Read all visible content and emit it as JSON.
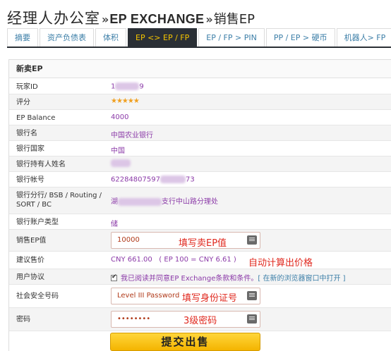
{
  "header": {
    "main": "经理人办公室",
    "sep1": "»",
    "section": "EP EXCHANGE",
    "sep2": "»",
    "sub": "销售EP"
  },
  "tabs": [
    {
      "label": "摘要",
      "active": false
    },
    {
      "label": "资产负债表",
      "active": false
    },
    {
      "label": "体积",
      "active": false
    },
    {
      "label": "EP <> EP / FP",
      "active": true
    },
    {
      "label": "EP / FP > PIN",
      "active": false
    },
    {
      "label": "PP / EP > 硬币",
      "active": false
    },
    {
      "label": "机器人> FP",
      "active": false
    }
  ],
  "panel_title": "新卖EP",
  "form": {
    "player_id": {
      "label": "玩家ID",
      "prefix": "1",
      "suffix": "9"
    },
    "rating": {
      "label": "评分",
      "stars": "★★★★★",
      "count": 5
    },
    "ep_balance": {
      "label": "EP Balance",
      "value": "4000"
    },
    "bank_name": {
      "label": "银行名",
      "value": "中国农业银行"
    },
    "bank_country": {
      "label": "银行国家",
      "value": "中国"
    },
    "holder_name": {
      "label": "银行持有人姓名"
    },
    "account_no": {
      "label": "银行帐号",
      "prefix": "62284807597",
      "suffix": "73"
    },
    "branch": {
      "label": "银行分行/ BSB / Routing / SORT / BC",
      "prefix": "湖",
      "suffix": "支行中山路分理处"
    },
    "account_type": {
      "label": "银行账户类型",
      "value": "储"
    },
    "sell_ep": {
      "label": "销售EP值",
      "value": "10000",
      "annotation": "填写卖EP值"
    },
    "suggested_price": {
      "label": "建议售价",
      "value": "CNY 661.00",
      "rate": "( EP 100 = CNY 6.61 )",
      "annotation": "自动计算出价格"
    },
    "agreement": {
      "label": "用户协议",
      "text": "我已阅读并同意EP Exchange条款和条件。",
      "link": "[ 在新的浏览器窗口中打开 ]",
      "checked": true
    },
    "ssn": {
      "label": "社会安全号码",
      "placeholder": "Level III Password",
      "annotation": "填写身份证号"
    },
    "password": {
      "label": "密码",
      "value": "••••••••",
      "annotation": "3级密码"
    }
  },
  "submit_label": "提交出售",
  "colors": {
    "accent": "#f5c400",
    "value_text": "#8b3aa8",
    "annotation": "#e0281e",
    "tab_active_bg": "#2a2f35",
    "link": "#3d7fa8"
  }
}
